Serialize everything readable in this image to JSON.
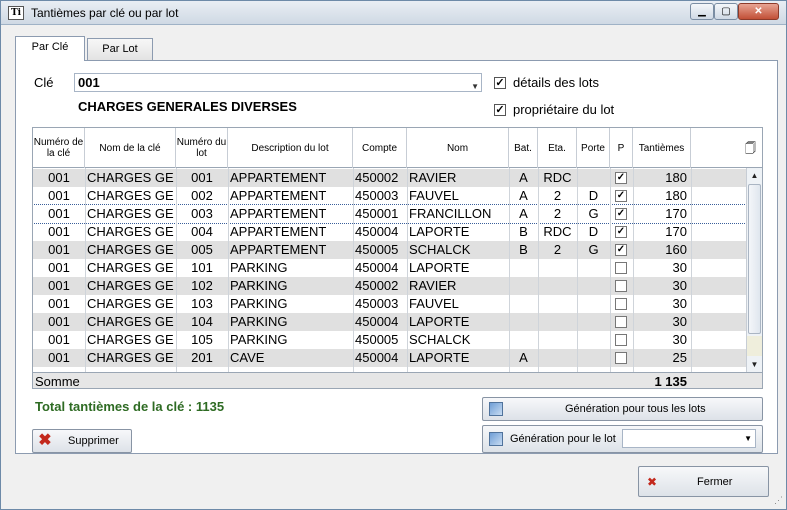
{
  "window": {
    "title": "Tantièmes par clé ou par lot",
    "icon_letter": "Ti"
  },
  "tabs": [
    {
      "label": "Par Clé"
    },
    {
      "label": "Par Lot"
    }
  ],
  "cle": {
    "label": "Clé",
    "value": "001",
    "description": "CHARGES GENERALES DIVERSES"
  },
  "options": {
    "details_lots": {
      "label": "détails des lots",
      "checked": true
    },
    "proprietaire_lot": {
      "label": "propriétaire du lot",
      "checked": true
    }
  },
  "grid": {
    "columns": [
      "Numéro de la clé",
      "Nom de la clé",
      "Numéro du lot",
      "Description du lot",
      "Compte",
      "Nom",
      "Bat.",
      "Eta.",
      "Porte",
      "P",
      "Tantièmes"
    ],
    "rows": [
      {
        "cle": "001",
        "nom_cle": "CHARGES GE",
        "lot": "001",
        "desc": "APPARTEMENT",
        "compte": "450002",
        "nom": "RAVIER",
        "bat": "A",
        "eta": "RDC",
        "porte": "",
        "p": true,
        "tant": "180"
      },
      {
        "cle": "001",
        "nom_cle": "CHARGES GE",
        "lot": "002",
        "desc": "APPARTEMENT",
        "compte": "450003",
        "nom": "FAUVEL",
        "bat": "A",
        "eta": "2",
        "porte": "D",
        "p": true,
        "tant": "180"
      },
      {
        "cle": "001",
        "nom_cle": "CHARGES GE",
        "lot": "003",
        "desc": "APPARTEMENT",
        "compte": "450001",
        "nom": "FRANCILLON",
        "bat": "A",
        "eta": "2",
        "porte": "G",
        "p": true,
        "tant": "170"
      },
      {
        "cle": "001",
        "nom_cle": "CHARGES GE",
        "lot": "004",
        "desc": "APPARTEMENT",
        "compte": "450004",
        "nom": "LAPORTE",
        "bat": "B",
        "eta": "RDC",
        "porte": "D",
        "p": true,
        "tant": "170"
      },
      {
        "cle": "001",
        "nom_cle": "CHARGES GE",
        "lot": "005",
        "desc": "APPARTEMENT",
        "compte": "450005",
        "nom": "SCHALCK",
        "bat": "B",
        "eta": "2",
        "porte": "G",
        "p": true,
        "tant": "160"
      },
      {
        "cle": "001",
        "nom_cle": "CHARGES GE",
        "lot": "101",
        "desc": "PARKING",
        "compte": "450004",
        "nom": "LAPORTE",
        "bat": "",
        "eta": "",
        "porte": "",
        "p": false,
        "tant": "30"
      },
      {
        "cle": "001",
        "nom_cle": "CHARGES GE",
        "lot": "102",
        "desc": "PARKING",
        "compte": "450002",
        "nom": "RAVIER",
        "bat": "",
        "eta": "",
        "porte": "",
        "p": false,
        "tant": "30"
      },
      {
        "cle": "001",
        "nom_cle": "CHARGES GE",
        "lot": "103",
        "desc": "PARKING",
        "compte": "450003",
        "nom": "FAUVEL",
        "bat": "",
        "eta": "",
        "porte": "",
        "p": false,
        "tant": "30"
      },
      {
        "cle": "001",
        "nom_cle": "CHARGES GE",
        "lot": "104",
        "desc": "PARKING",
        "compte": "450004",
        "nom": "LAPORTE",
        "bat": "",
        "eta": "",
        "porte": "",
        "p": false,
        "tant": "30"
      },
      {
        "cle": "001",
        "nom_cle": "CHARGES GE",
        "lot": "105",
        "desc": "PARKING",
        "compte": "450005",
        "nom": "SCHALCK",
        "bat": "",
        "eta": "",
        "porte": "",
        "p": false,
        "tant": "30"
      },
      {
        "cle": "001",
        "nom_cle": "CHARGES GE",
        "lot": "201",
        "desc": "CAVE",
        "compte": "450004",
        "nom": "LAPORTE",
        "bat": "A",
        "eta": "",
        "porte": "",
        "p": false,
        "tant": "25"
      }
    ],
    "selected_row": 2,
    "sum_label": "Somme",
    "sum_value": "1 135"
  },
  "total_label": "Total tantièmes de la clé : 1135",
  "buttons": {
    "generation_tous": "Génération pour tous les lots",
    "generation_lot": "Génération pour le lot",
    "supprimer": "Supprimer",
    "fermer": "Fermer"
  },
  "lot_select": {
    "value": ""
  }
}
